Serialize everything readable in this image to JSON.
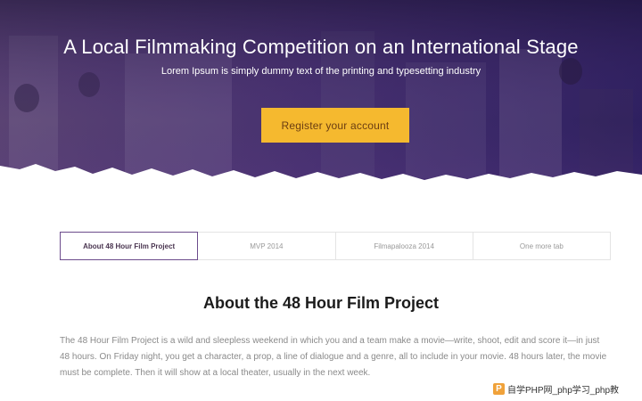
{
  "hero": {
    "title": "A Local Filmmaking Competition on an International Stage",
    "subtitle": "Lorem Ipsum is simply dummy text of the printing and typesetting industry",
    "cta_label": "Register your account"
  },
  "tabs": [
    {
      "label": "About 48 Hour Film Project",
      "active": true
    },
    {
      "label": "MVP 2014",
      "active": false
    },
    {
      "label": "Filmapalooza 2014",
      "active": false
    },
    {
      "label": "One more tab",
      "active": false
    }
  ],
  "section": {
    "title": "About the 48 Hour Film Project",
    "body": "The 48 Hour Film Project is a wild and sleepless weekend in which you and a team make a movie—write, shoot, edit and score it—in just 48 hours. On Friday night, you get a character, a prop, a line of dialogue and a genre, all to include in your movie. 48 hours later, the movie must be complete. Then it will show at a local theater, usually in the next week."
  },
  "watermark": {
    "logo_letter": "P",
    "text": "自学PHP网_php学习_php教"
  },
  "colors": {
    "hero_purple": "#3d2a6b",
    "cta_yellow": "#f5b92f",
    "active_tab_border": "#6c4b8c"
  }
}
